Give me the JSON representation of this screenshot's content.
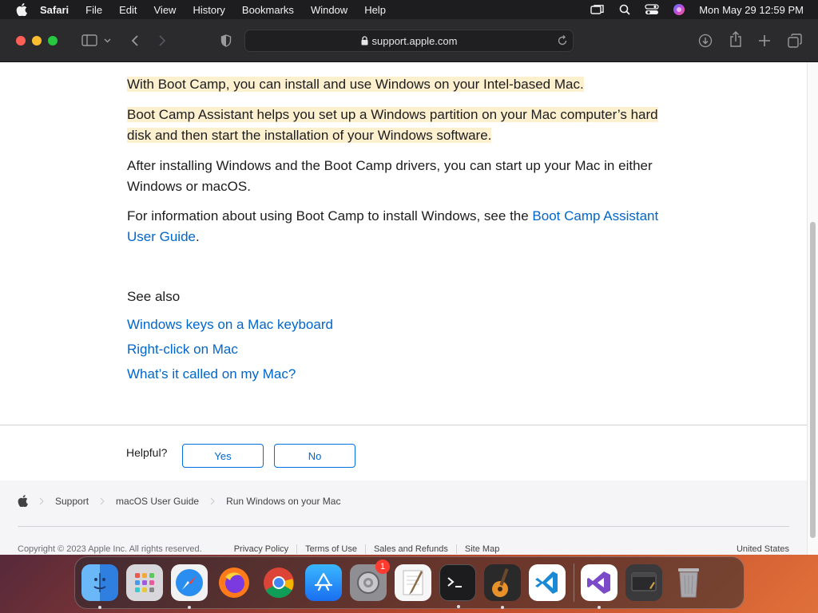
{
  "menubar": {
    "app": "Safari",
    "items": [
      "File",
      "Edit",
      "View",
      "History",
      "Bookmarks",
      "Window",
      "Help"
    ],
    "clock": "Mon May 29  12:59 PM"
  },
  "toolbar": {
    "url": "support.apple.com"
  },
  "article": {
    "p1": "With Boot Camp, you can install and use Windows on your Intel-based Mac.",
    "p2_line1": "Boot Camp Assistant helps you set up a Windows partition on your Mac computer’s hard",
    "p2_line2": "disk and then start the installation of your Windows software.",
    "p3_line1": "After installing Windows and the Boot Camp drivers, you can start up your Mac in either",
    "p3_line2": "Windows or macOS.",
    "p4_text": "For information about using Boot Camp to install Windows, see the ",
    "p4_link_line1": "Boot Camp Assistant",
    "p4_link_line2": "User Guide",
    "p4_end": ".",
    "see_also": "See also",
    "related": [
      "Windows keys on a Mac keyboard",
      "Right-click on Mac",
      "What’s it called on my Mac?"
    ]
  },
  "feedback": {
    "label": "Helpful?",
    "yes": "Yes",
    "no": "No"
  },
  "footer": {
    "breadcrumbs": [
      "Support",
      "macOS User Guide",
      "Run Windows on your Mac"
    ],
    "copyright": "Copyright © 2023 Apple Inc. All rights reserved.",
    "links": [
      "Privacy Policy",
      "Terms of Use",
      "Sales and Refunds",
      "Site Map"
    ],
    "region": "United States"
  },
  "dock": {
    "apps": [
      "finder",
      "launchpad",
      "safari",
      "firefox",
      "chrome",
      "app-store",
      "system-settings",
      "textedit",
      "terminal",
      "garageband",
      "vscode",
      "visual-studio",
      "preview",
      "trash"
    ],
    "settings_badge": "1"
  },
  "colors": {
    "link": "#0066cc",
    "highlight": "#fdf0cf",
    "toolbar": "#2b2b2d"
  }
}
